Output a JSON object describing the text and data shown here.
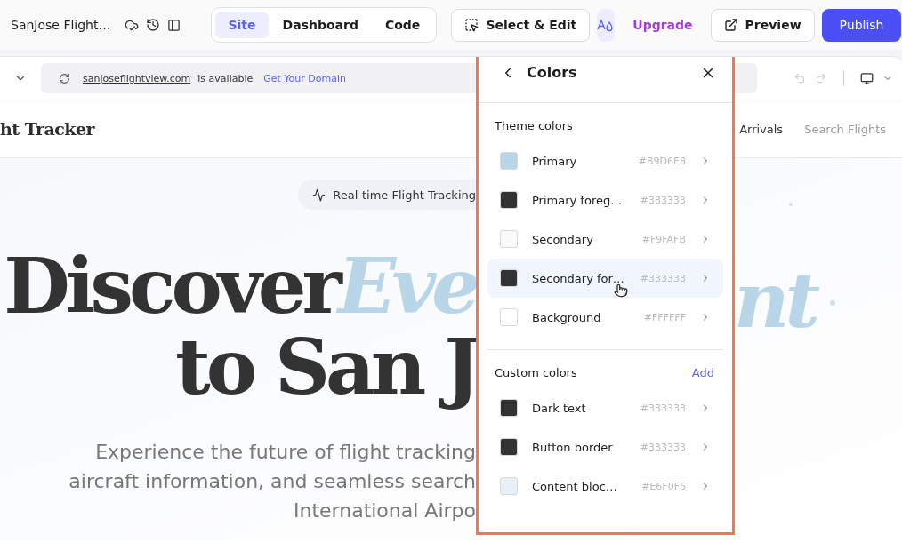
{
  "topbar": {
    "site_name": "SanJose Flight…",
    "tabs": [
      {
        "label": "Site",
        "selected": true
      },
      {
        "label": "Dashboard",
        "selected": false
      },
      {
        "label": "Code",
        "selected": false
      }
    ],
    "select_edit": "Select & Edit",
    "theme_button": {
      "active": true
    },
    "upgrade": "Upgrade",
    "preview": "Preview",
    "publish": "Publish"
  },
  "address_bar": {
    "domain": "sanjoseflightview.com",
    "status": "is available",
    "link": "Get Your Domain"
  },
  "site": {
    "logo": "ht Tracker",
    "nav": [
      "Arrivals",
      "Search Flights"
    ],
    "badge": "Real-time Flight Tracking",
    "headline_dark": "Discover",
    "headline_accent": "Eve",
    "headline_accent_right": "nt",
    "headline_line2": "to San J",
    "paragraph_lines": [
      "Experience the future of flight tracking",
      "aircraft information, and seamless search",
      "International Airpo"
    ]
  },
  "colors_panel": {
    "title": "Colors",
    "theme_heading": "Theme colors",
    "theme_colors": [
      {
        "name": "Primary",
        "hex": "#B9D6E8",
        "color": "#b9d6e8",
        "highlighted": false
      },
      {
        "name": "Primary foreg…",
        "hex": "#333333",
        "color": "#333333",
        "highlighted": false
      },
      {
        "name": "Secondary",
        "hex": "#F9FAFB",
        "color": "#f9fafb",
        "highlighted": false
      },
      {
        "name": "Secondary for…",
        "hex": "#333333",
        "color": "#333333",
        "highlighted": true
      },
      {
        "name": "Background",
        "hex": "#FFFFFF",
        "color": "#ffffff",
        "highlighted": false
      }
    ],
    "custom_heading": "Custom colors",
    "add": "Add",
    "custom_colors": [
      {
        "name": "Dark text",
        "hex": "#333333",
        "color": "#333333",
        "highlighted": false
      },
      {
        "name": "Button border",
        "hex": "#333333",
        "color": "#333333",
        "highlighted": false
      },
      {
        "name": "Content bloc…",
        "hex": "#E6F0F6",
        "color": "#e6f0f6",
        "highlighted": false
      }
    ]
  }
}
